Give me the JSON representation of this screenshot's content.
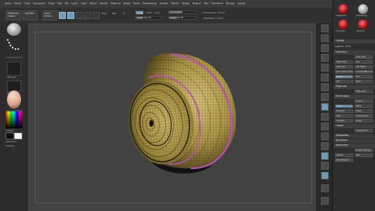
{
  "menubar": {
    "items": [
      "Alpha",
      "Brush",
      "Color",
      "Document",
      "Draw",
      "Edit",
      "File",
      "Layer",
      "Light",
      "Macro",
      "Marker",
      "Material",
      "Movie",
      "Picker",
      "Preferences",
      "Render",
      "Stencil",
      "Stroke",
      "Texture",
      "Tool",
      "Transform",
      "Zplugin",
      "Zscript"
    ],
    "right": [
      "Menus",
      "DefaultZScript"
    ]
  },
  "toolbar": {
    "projection_master": "Projection Master",
    "lightbox": "LightBox",
    "quick_sketch": "Quick Sketch",
    "mrgb": "Mrgb",
    "rgb": "Rgb",
    "m": "M",
    "zadd": "Zadd",
    "zsub": "Zsub",
    "zcut": "Zcut",
    "focal_shift": "Focal Shift 0",
    "draw_size": "Draw Size 64",
    "rgb_intensity": "Rgb Intensity 100",
    "z_intensity": "Z Intensity 25",
    "active_points": "ActivePoints: 19,212",
    "total_points": "TotalPoints: 19,212"
  },
  "left": {
    "alpha_off": "Alpha Off",
    "texture_off": "Texture Off",
    "gradient": "Gradient",
    "switch_color": "SwitchColor",
    "alternate": "Alternate"
  },
  "palette": {
    "tool_names": [
      "PolyMesh3D",
      "SimpleBrush",
      "Cylinder3D",
      "Sphere3D"
    ],
    "subtool": "SubTool",
    "lightbox_tools": "Lightbox› Tools",
    "items": [
      "Geometry",
      "Lower Res",
      "Higher Res",
      "Sdiv",
      "Del Lower",
      "Del Higher",
      "Reconstruct Subdiv",
      "Convert BPR To Geo",
      "Divide",
      "Smt",
      "Suv",
      "ReUV",
      "EdgeLoop",
      "Edge Loop",
      "Panel Loops",
      "Loops 4",
      "Polish",
      "Bevel",
      "Elevation",
      "Inflate",
      "Align",
      "GroupsLoops",
      "Triangles",
      "Stager",
      "Crease",
      "CreaseLvl 15",
      "UnCreaseAll",
      "ShadowBox",
      "ClayPolish",
      "DynaMesh",
      "qRemesher",
      "Modify Topology",
      "Position",
      "Size",
      "MeshIntegrity"
    ]
  },
  "colors": {
    "accent": "#6e9bb6",
    "mesh_yellow": "#b9a24a",
    "polygroup_magenta": "#c04cc8",
    "canvas": "#424242"
  }
}
